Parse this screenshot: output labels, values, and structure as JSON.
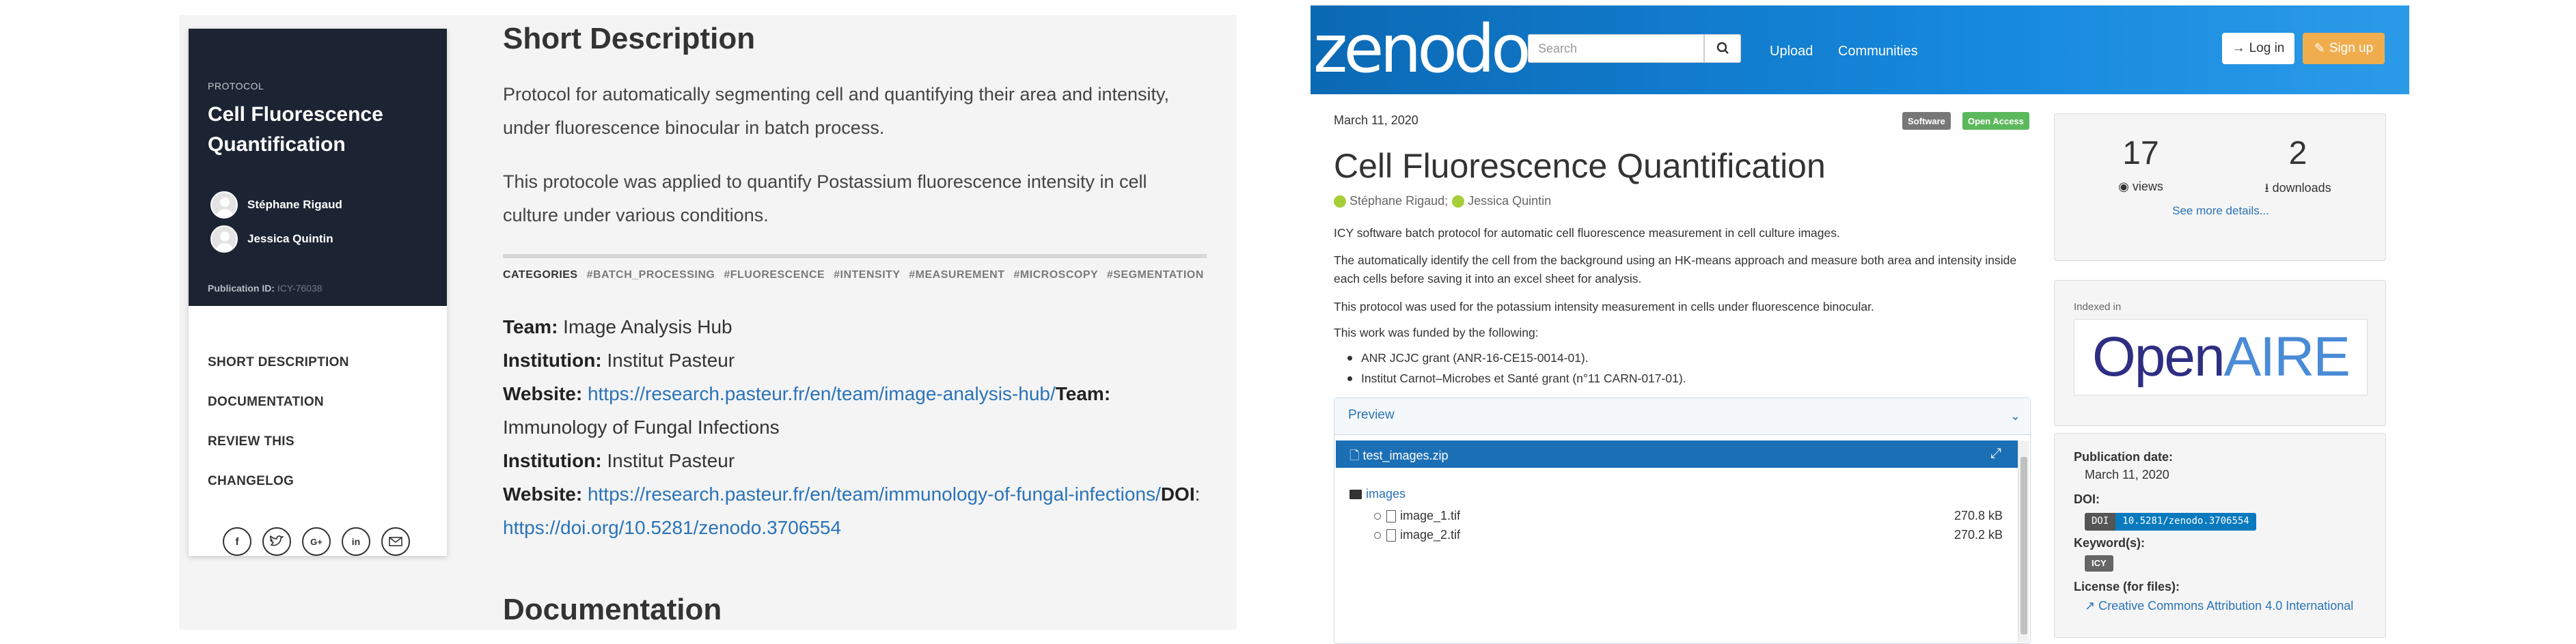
{
  "left": {
    "card": {
      "label": "PROTOCOL",
      "title": "Cell Fluorescence Quantification",
      "authors": [
        "Stéphane Rigaud",
        "Jessica Quintin"
      ],
      "pub_id_label": "Publication ID:",
      "pub_id_value": "ICY-76038",
      "nav": [
        "SHORT DESCRIPTION",
        "DOCUMENTATION",
        "REVIEW THIS",
        "CHANGELOG"
      ],
      "share_icons": [
        "facebook-icon",
        "twitter-icon",
        "google-plus-icon",
        "linkedin-icon",
        "email-icon"
      ]
    },
    "short_description": {
      "heading": "Short Description",
      "para1": "Protocol for automatically segmenting cell and quantifying their area and intensity, under fluorescence binocular in batch process.",
      "para2": "This protocole was applied to quantify Postassium fluorescence intensity in cell culture under various conditions."
    },
    "categories": {
      "label": "CATEGORIES",
      "tags": [
        "#BATCH_PROCESSING",
        "#FLUORESCENCE",
        "#INTENSITY",
        "#MEASUREMENT",
        "#MICROSCOPY",
        "#SEGMENTATION"
      ]
    },
    "info": {
      "team_label": "Team:",
      "team1": "Image Analysis Hub",
      "institution_label": "Institution:",
      "institution1": "Institut Pasteur",
      "website_label": "Website:",
      "website1": "https://research.pasteur.fr/en/team/image-analysis-hub/",
      "team2": "Immunology of Fungal Infections",
      "institution2": "Institut Pasteur",
      "website2": "https://research.pasteur.fr/en/team/immunology-of-fungal-infections/",
      "doi_label": "DOI",
      "doi_link": "https://doi.org/10.5281/zenodo.3706554"
    },
    "documentation_heading": "Documentation"
  },
  "zenodo": {
    "logo": "zenodo",
    "search_placeholder": "Search",
    "nav": [
      "Upload",
      "Communities"
    ],
    "login": "Log in",
    "signup": "Sign up",
    "date": "March 11, 2020",
    "badges": [
      {
        "label": "Software",
        "color": "#777777"
      },
      {
        "label": "Open Access",
        "color": "#5cb85c"
      }
    ],
    "title": "Cell Fluorescence Quantification",
    "authors": [
      "Stéphane Rigaud;",
      "Jessica Quintin"
    ],
    "desc1": "ICY software batch protocol for automatic cell fluorescence measurement in cell culture images.",
    "desc2": "The automatically identify the cell from the background using an HK-means approach and measure both area and intensity inside each cells before saving it into an excel sheet for analysis.",
    "desc3": "This protocol was used for the potassium intensity measurement in cells under fluorescence binocular.",
    "desc4": "This work was funded by the following:",
    "funding": [
      "ANR JCJC grant (ANR-16-CE15-0014-01).",
      "Institut Carnot–Microbes et Santé grant (n°11 CARN-017-01)."
    ],
    "preview": {
      "heading": "Preview",
      "zip": "test_images.zip",
      "folder": "images",
      "files": [
        {
          "name": "image_1.tif",
          "size": "270.8 kB"
        },
        {
          "name": "image_2.tif",
          "size": "270.2 kB"
        }
      ]
    },
    "stats": {
      "views": "17",
      "views_label": "views",
      "downloads": "2",
      "downloads_label": "downloads",
      "see_more": "See more details..."
    },
    "indexed_in": "Indexed in",
    "openaire_logo": {
      "part1": "Open",
      "part2": "AIRE"
    },
    "meta": {
      "pub_date_label": "Publication date:",
      "pub_date": "March 11, 2020",
      "doi_label": "DOI:",
      "doi_key": "DOI",
      "doi_value": "10.5281/zenodo.3706554",
      "keywords_label": "Keyword(s):",
      "keyword": "ICY",
      "license_label": "License (for files):",
      "license": "Creative Commons Attribution 4.0 International"
    }
  }
}
